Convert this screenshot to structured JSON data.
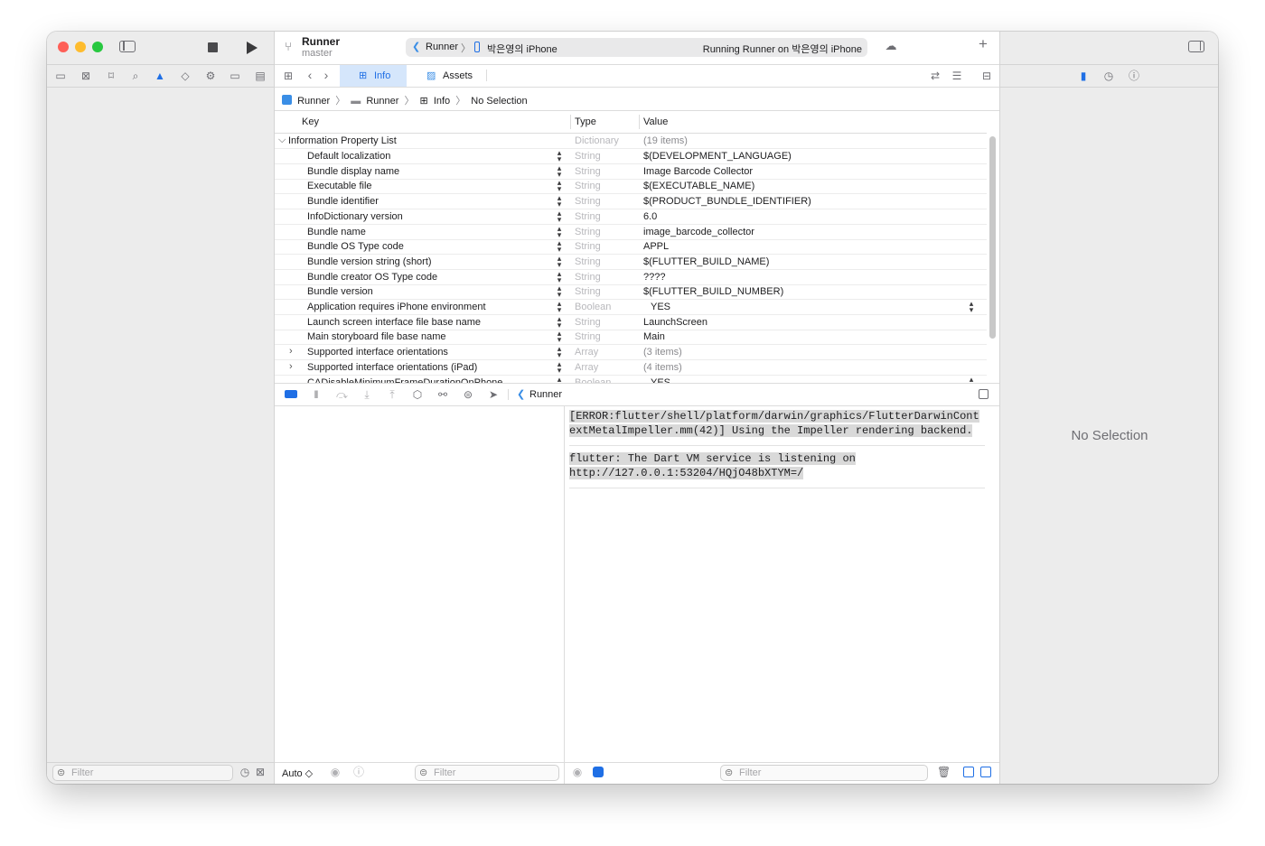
{
  "toolbar": {
    "project_name": "Runner",
    "branch": "master",
    "scheme": "Runner",
    "device": "박은영의 iPhone",
    "status": "Running Runner on 박은영의 iPhone",
    "add_label": "+"
  },
  "editor_tabs": [
    {
      "label": "Info",
      "active": true
    },
    {
      "label": "Assets",
      "active": false
    }
  ],
  "breadcrumb": [
    "Runner",
    "Runner",
    "Info",
    "No Selection"
  ],
  "plist": {
    "headers": {
      "key": "Key",
      "type": "Type",
      "value": "Value"
    },
    "root": {
      "key": "Information Property List",
      "type": "Dictionary",
      "value": "(19 items)"
    },
    "rows": [
      {
        "key": "Default localization",
        "type": "String",
        "value": "$(DEVELOPMENT_LANGUAGE)"
      },
      {
        "key": "Bundle display name",
        "type": "String",
        "value": "Image Barcode Collector"
      },
      {
        "key": "Executable file",
        "type": "String",
        "value": "$(EXECUTABLE_NAME)"
      },
      {
        "key": "Bundle identifier",
        "type": "String",
        "value": "$(PRODUCT_BUNDLE_IDENTIFIER)"
      },
      {
        "key": "InfoDictionary version",
        "type": "String",
        "value": "6.0"
      },
      {
        "key": "Bundle name",
        "type": "String",
        "value": "image_barcode_collector"
      },
      {
        "key": "Bundle OS Type code",
        "type": "String",
        "value": "APPL"
      },
      {
        "key": "Bundle version string (short)",
        "type": "String",
        "value": "$(FLUTTER_BUILD_NAME)"
      },
      {
        "key": "Bundle creator OS Type code",
        "type": "String",
        "value": "????"
      },
      {
        "key": "Bundle version",
        "type": "String",
        "value": "$(FLUTTER_BUILD_NUMBER)"
      },
      {
        "key": "Application requires iPhone environment",
        "type": "Boolean",
        "value": "YES"
      },
      {
        "key": "Launch screen interface file base name",
        "type": "String",
        "value": "LaunchScreen"
      },
      {
        "key": "Main storyboard file base name",
        "type": "String",
        "value": "Main"
      },
      {
        "key": "Supported interface orientations",
        "type": "Array",
        "value": "(3 items)"
      },
      {
        "key": "Supported interface orientations (iPad)",
        "type": "Array",
        "value": "(4 items)"
      },
      {
        "key": "CADisableMinimumFrameDurationOnPhone",
        "type": "Boolean",
        "value": "YES"
      }
    ]
  },
  "debug_bar": {
    "target": "Runner"
  },
  "console": {
    "messages": [
      "[ERROR:flutter/shell/platform/darwin/graphics/FlutterDarwinContextMetalImpeller.mm(42)] Using the Impeller rendering backend.",
      "flutter: The Dart VM service is listening on http://127.0.0.1:53204/HQjO48bXTYM=/"
    ]
  },
  "bottom": {
    "nav_filter_placeholder": "Filter",
    "variables_mode": "Auto ◇",
    "variables_filter_placeholder": "Filter",
    "console_filter_placeholder": "Filter"
  },
  "inspector": {
    "empty_text": "No Selection"
  },
  "colors": {
    "accent": "#1f6fe5",
    "close": "#fe5f57",
    "minimize": "#febc2e",
    "zoom": "#28c840"
  }
}
